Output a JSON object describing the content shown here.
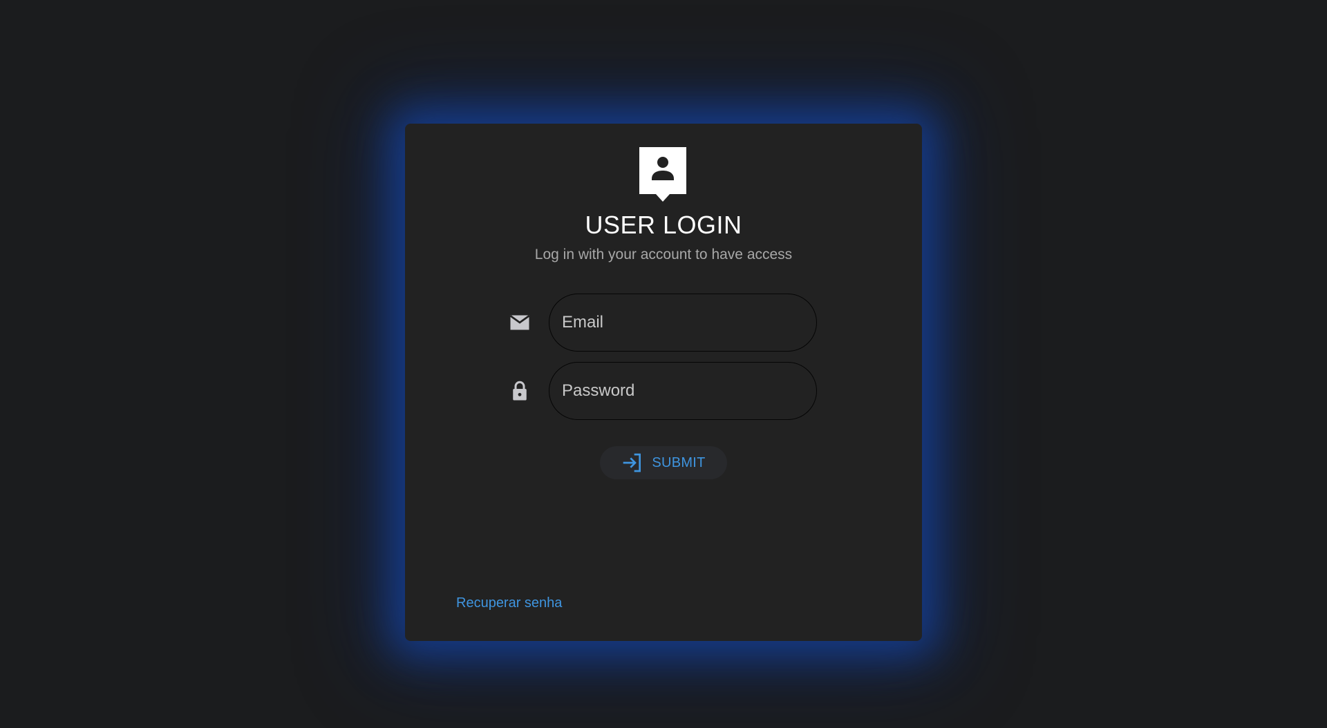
{
  "login": {
    "title": "USER LOGIN",
    "subtitle": "Log in with your account to have access",
    "email_placeholder": "Email",
    "password_placeholder": "Password",
    "submit_label": "SUBMIT",
    "recover_label": "Recuperar senha"
  },
  "icons": {
    "avatar": "person-icon",
    "email": "mail-icon",
    "password": "lock-icon",
    "submit": "login-arrow-icon"
  },
  "colors": {
    "background": "#1b1c1e",
    "card": "#222222",
    "glow": "#154096",
    "accent": "#3f95e0"
  }
}
